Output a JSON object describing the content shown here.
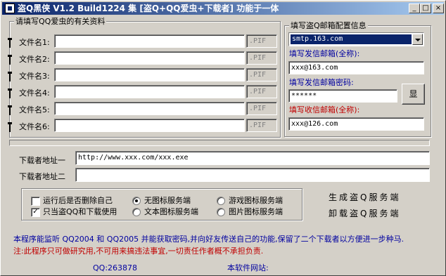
{
  "window": {
    "title": "盗Q黑侠 V1.2 Build1224  集 [盗Q+QQ爱虫+下载者] 功能于一体",
    "controls": {
      "minimize": "_",
      "maximize": "□",
      "close": "×"
    }
  },
  "files": {
    "group_title": "请填写QQ爱虫的有关资料",
    "rows": [
      {
        "label": "文件名1:",
        "value": "",
        "ext": ".PIF"
      },
      {
        "label": "文件名2:",
        "value": "",
        "ext": ".PIF"
      },
      {
        "label": "文件名3:",
        "value": "",
        "ext": ".PIF"
      },
      {
        "label": "文件名4:",
        "value": "",
        "ext": ".PIF"
      },
      {
        "label": "文件名5:",
        "value": "",
        "ext": ".PIF"
      },
      {
        "label": "文件名6:",
        "value": "",
        "ext": ".PIF"
      }
    ]
  },
  "mail": {
    "group_title": "填写盗Q邮箱配置信息",
    "smtp_selected": "smtp.163.com",
    "sender_label": "填写发信邮箱(全称):",
    "sender_value": "xxx@163.com",
    "password_label": "填写发信邮箱密码:",
    "password_value": "******",
    "show_button": "显",
    "receiver_label": "填写收信邮箱(全称):",
    "receiver_value": "xxx@126.com"
  },
  "downloader": {
    "url1_label": "下载者地址一",
    "url1_value": "http://www.xxx.com/xxx.exe",
    "url2_label": "下载者地址二",
    "url2_value": ""
  },
  "options": {
    "checkbox_delete": {
      "label": "运行后是否删除自己",
      "checked": false
    },
    "checkbox_only": {
      "label": "只当盗QQ和下载使用",
      "checked": true
    },
    "radio_none": {
      "label": "无图标服务端",
      "selected": true
    },
    "radio_text": {
      "label": "文本图标服务端",
      "selected": false
    },
    "radio_game": {
      "label": "游戏图标服务端",
      "selected": false
    },
    "radio_image": {
      "label": "图片图标服务端",
      "selected": false
    }
  },
  "actions": {
    "generate": "生成盗Q服务端",
    "uninstall": "卸载盗Q服务端"
  },
  "footer": {
    "line1": "本程序能监听 QQ2004 和 QQ2005 并能获取密码,并向好友传送自己的功能,保留了二个下载者以方便进一步种马.",
    "line2": "注:此程序只可做研究用,不可用来搞违法事宜,一切责任作者概不承担负责.",
    "qq": "QQ:263878",
    "website": "本软件网站:"
  },
  "colors": {
    "title_bar": "#0a246a",
    "blue_text": "#0000a0",
    "red_text": "#c00000",
    "face": "#d4d0c8"
  }
}
